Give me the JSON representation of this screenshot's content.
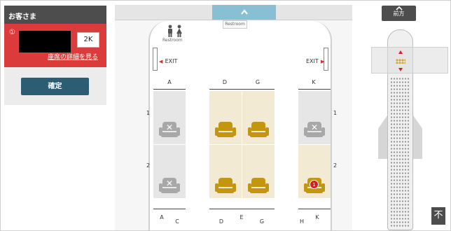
{
  "passenger_panel": {
    "title": "お客さま",
    "passenger_number": "①",
    "seat": "2K",
    "details_link": "座席の詳細を見る",
    "confirm_label": "確定",
    "name_redacted": true
  },
  "cabin": {
    "scroll_up_icon": "chevron-up-icon",
    "scroll_up_label": "^",
    "restroom_label": "Restroom",
    "restroom_tag": "Restroom",
    "exit_left": "EXIT",
    "exit_right": "EXIT",
    "top_columns": [
      "A",
      "D",
      "G",
      "K"
    ],
    "rows": [
      "1",
      "2"
    ],
    "bottom_columns": [
      "A",
      "C",
      "D",
      "E",
      "G",
      "H",
      "K"
    ],
    "seats": [
      {
        "id": "1A",
        "status": "occupied"
      },
      {
        "id": "1D",
        "status": "available"
      },
      {
        "id": "1G",
        "status": "available"
      },
      {
        "id": "1K",
        "status": "occupied"
      },
      {
        "id": "2A",
        "status": "occupied"
      },
      {
        "id": "2D",
        "status": "available"
      },
      {
        "id": "2G",
        "status": "available"
      },
      {
        "id": "2K",
        "status": "selected",
        "badge": "1"
      }
    ],
    "colors": {
      "available": "#c4950f",
      "occupied": "#a8a8a8",
      "selected_badge": "#d42020",
      "premium_zone": "#f2ead2"
    }
  },
  "mini_map": {
    "front_label": "前方",
    "front_icon": "chevron-up-icon",
    "scroll_top_icon": "arrow-up-to-top-icon",
    "scroll_top_label": "不"
  }
}
